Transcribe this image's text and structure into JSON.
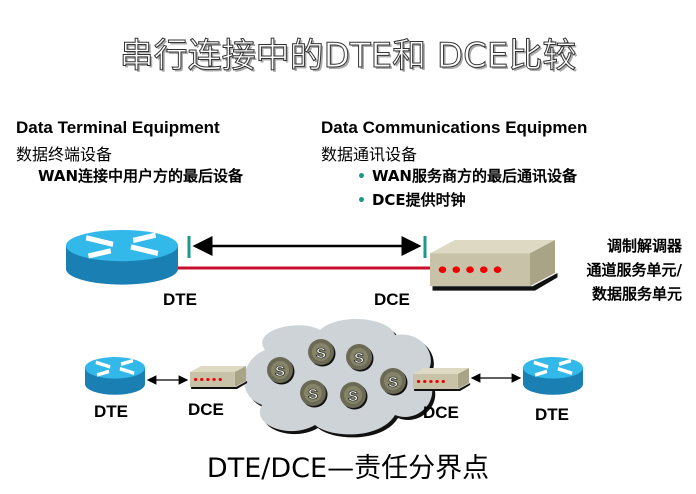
{
  "title": "串行连接中的DTE和 DCE比较",
  "dte": {
    "heading": "Data Terminal Equipment",
    "cn": "数据终端设备",
    "desc": "WAN连接中用户方的最后设备"
  },
  "dce": {
    "heading": "Data Communications Equipmen",
    "cn": "数据通讯设备",
    "bullets": [
      "WAN服务商方的最后通讯设备",
      "DCE提供时钟"
    ]
  },
  "top_diagram": {
    "dte_label": "DTE",
    "dce_label": "DCE",
    "device_labels": [
      "调制解调器",
      "通道服务单元/",
      "数据服务单元"
    ]
  },
  "bottom_diagram": {
    "labels": [
      "DTE",
      "DCE",
      "DCE",
      "DTE"
    ],
    "switch_label": "S"
  },
  "footer": "DTE/DCE—责任分界点",
  "colors": {
    "router": "#1e9fd8",
    "link": "#c8102e",
    "marker": "#1a9a8a",
    "modem": "#c8c3a8",
    "switch": "#6b6a55",
    "cloud": "#cdd3d6"
  }
}
